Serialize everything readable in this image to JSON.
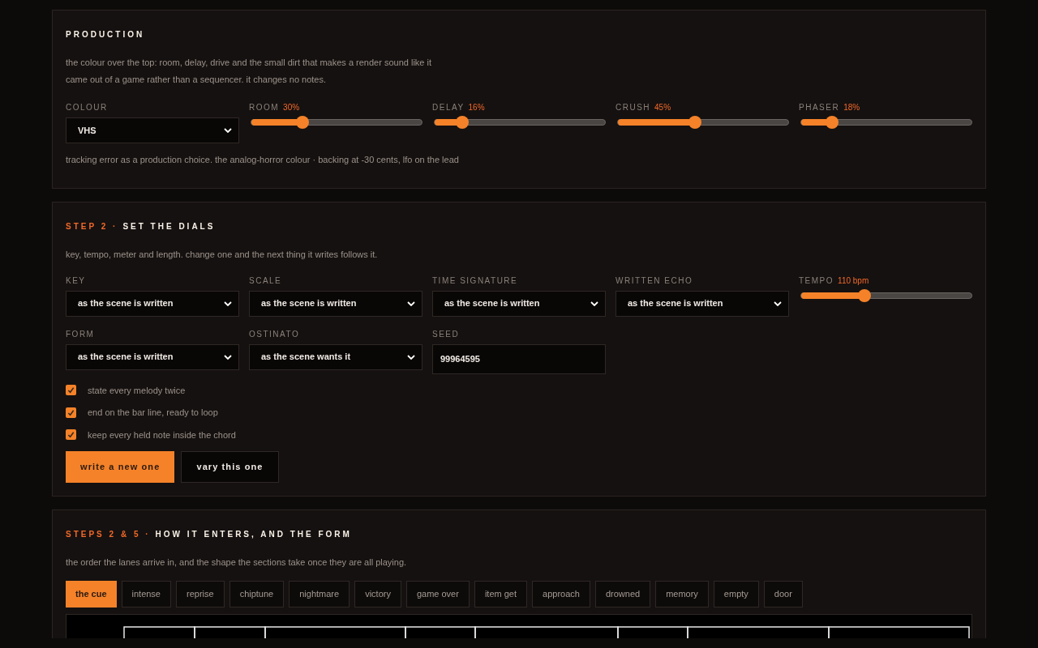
{
  "production": {
    "title": "PRODUCTION",
    "description": "the colour over the top: room, delay, drive and the small dirt that makes a render sound like it came out of a game rather than a sequencer. it changes no notes.",
    "colour": {
      "label": "COLOUR",
      "value": "VHS"
    },
    "sliders": [
      {
        "label": "ROOM",
        "reading": "30%",
        "level": 0.3
      },
      {
        "label": "DELAY",
        "reading": "16%",
        "level": 0.16
      },
      {
        "label": "CRUSH",
        "reading": "45%",
        "level": 0.45
      },
      {
        "label": "PHASER",
        "reading": "18%",
        "level": 0.18
      }
    ],
    "note": "tracking error as a production choice. the analog-horror colour · backing at -30 cents, lfo on the lead"
  },
  "dials": {
    "step": "STEP 2 ·",
    "title": "SET THE DIALS",
    "description": "key, tempo, meter and length. change one and the next thing it writes follows it.",
    "fields": [
      {
        "kind": "select",
        "label": "KEY",
        "value": "as the scene is written"
      },
      {
        "kind": "select",
        "label": "SCALE",
        "value": "as the scene is written"
      },
      {
        "kind": "select",
        "label": "TIME SIGNATURE",
        "value": "as the scene is written"
      },
      {
        "kind": "select",
        "label": "WRITTEN ECHO",
        "value": "as the scene is written"
      },
      {
        "kind": "slider",
        "label": "TEMPO",
        "reading": "110 bpm",
        "level": 0.37
      },
      {
        "kind": "select",
        "label": "FORM",
        "value": "as the scene is written"
      },
      {
        "kind": "select",
        "label": "OSTINATO",
        "value": "as the scene wants it"
      },
      {
        "kind": "input",
        "label": "SEED",
        "value": "99964595"
      }
    ],
    "options": [
      {
        "label": "state every melody twice",
        "checked": true
      },
      {
        "label": "end on the bar line, ready to loop",
        "checked": true
      },
      {
        "label": "keep every held note inside the chord",
        "checked": true
      }
    ],
    "buttons": [
      {
        "label": "write a new one",
        "kind": "primary"
      },
      {
        "label": "vary this one",
        "kind": "secondary"
      }
    ]
  },
  "form": {
    "step": "STEPS 2 & 5 ·",
    "title": "HOW IT ENTERS, AND THE FORM",
    "description": "the order the lanes arrive in, and the shape the sections take once they are all playing.",
    "presets": [
      {
        "label": "the cue",
        "selected": true
      },
      {
        "label": "intense",
        "selected": false
      },
      {
        "label": "reprise",
        "selected": false
      },
      {
        "label": "chiptune",
        "selected": false
      },
      {
        "label": "nightmare",
        "selected": false
      },
      {
        "label": "victory",
        "selected": false
      },
      {
        "label": "game over",
        "selected": false
      },
      {
        "label": "item get",
        "selected": false
      },
      {
        "label": "approach",
        "selected": false
      },
      {
        "label": "drowned",
        "selected": false
      },
      {
        "label": "memory",
        "selected": false
      },
      {
        "label": "empty",
        "selected": false
      },
      {
        "label": "door",
        "selected": false
      }
    ]
  }
}
